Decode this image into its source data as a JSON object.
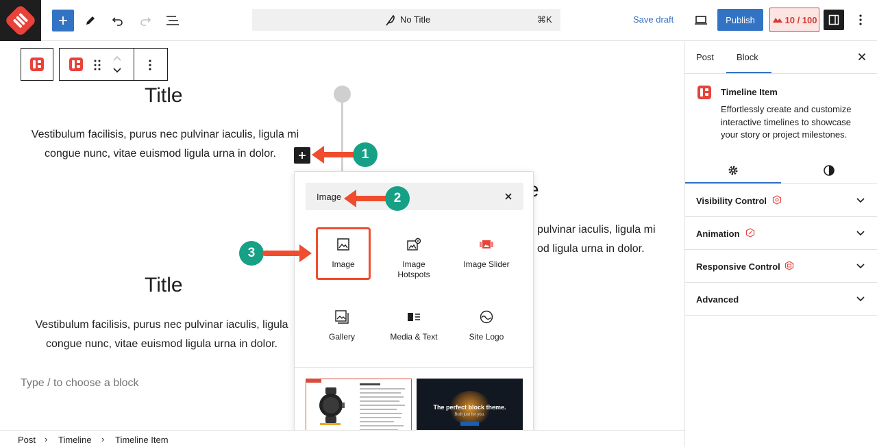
{
  "topbar": {
    "doc_title": "No Title",
    "shortcut": "⌘K",
    "save_draft": "Save draft",
    "publish": "Publish",
    "score": "10 / 100"
  },
  "canvas": {
    "block1": {
      "title": "Title",
      "para_line1": "Vestibulum facilisis, purus nec pulvinar iaculis, ligula mi",
      "para_line2": "congue nunc, vitae euismod ligula urna in dolor."
    },
    "block2_partial": {
      "title_fragment": "e",
      "para_line1": "pulvinar iaculis, ligula mi",
      "para_line2": "od ligula urna in dolor."
    },
    "block3": {
      "title": "Title",
      "para_line1": "Vestibulum facilisis, purus nec pulvinar iaculis, ligula",
      "para_line2": "congue nunc, vitae euismod ligula urna in dolor."
    },
    "placeholder": "Type / to choose a block"
  },
  "annotations": {
    "badge1": "1",
    "badge2": "2",
    "badge3": "3"
  },
  "inserter": {
    "search_value": "Image",
    "blocks": [
      {
        "label": "Image",
        "icon": "image-icon"
      },
      {
        "label": "Image Hotspots",
        "icon": "image-hotspots-icon"
      },
      {
        "label": "Image Slider",
        "icon": "image-slider-icon"
      },
      {
        "label": "Gallery",
        "icon": "gallery-icon"
      },
      {
        "label": "Media & Text",
        "icon": "media-text-icon"
      },
      {
        "label": "Site Logo",
        "icon": "site-logo-icon"
      }
    ],
    "pattern2_heading": "The perfect block theme.",
    "pattern2_sub": "Built just for you."
  },
  "breadcrumb": [
    "Post",
    "Timeline",
    "Timeline Item"
  ],
  "sidebar": {
    "tabs": [
      "Post",
      "Block"
    ],
    "block_name": "Timeline Item",
    "block_desc": "Effortlessly create and customize interactive timelines to showcase your story or project milestones.",
    "panels": [
      "Visibility Control",
      "Animation",
      "Responsive Control",
      "Advanced"
    ]
  },
  "colors": {
    "accent": "#3373c4",
    "brand_red": "#e8423a",
    "annotation_orange": "#ef4d2d",
    "annotation_teal": "#16a085"
  }
}
